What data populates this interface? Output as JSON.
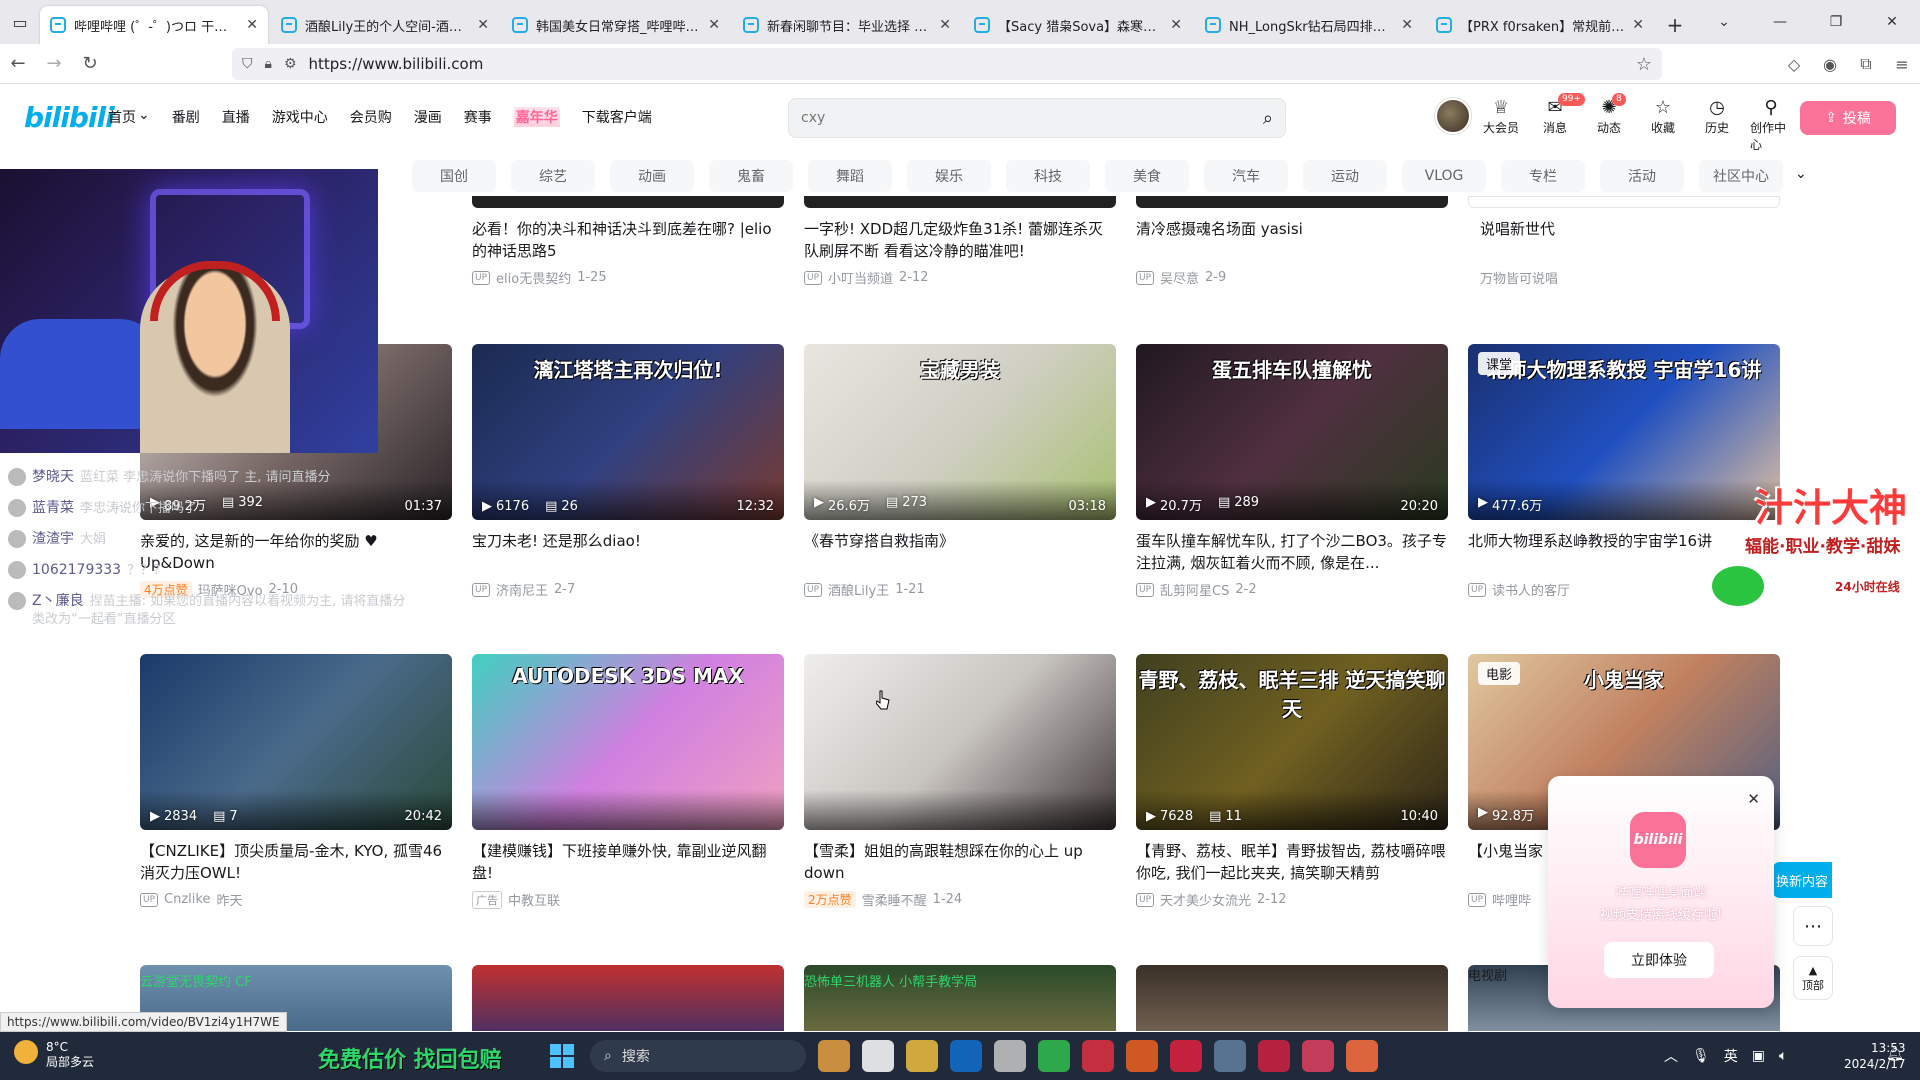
{
  "browser": {
    "tabs": [
      {
        "label": "哔哩哔哩 (゜-゜)つロ 干杯~-bi",
        "active": true
      },
      {
        "label": "酒酿Lily王的个人空间-酒酿Lily",
        "active": false
      },
      {
        "label": "韩国美女日常穿搭_哔哩哔哩_bi",
        "active": false
      },
      {
        "label": "新春闲聊节目：毕业选择 | 为什",
        "active": false
      },
      {
        "label": "【Sacy 猎枭Sova】森寒冬港29",
        "active": false
      },
      {
        "label": "NH_LongSkr钻石局四排20杀秒",
        "active": false
      },
      {
        "label": "【PRX f0rsaken】常规前压和",
        "active": false
      }
    ],
    "url": "https://www.bilibili.com",
    "status_url": "https://www.bilibili.com/video/BV1zi4y1H7WE"
  },
  "header": {
    "logo": "bilibili",
    "nav": [
      "首页",
      "番剧",
      "直播",
      "游戏中心",
      "会员购",
      "漫画",
      "赛事",
      "嘉年华",
      "下载客户端"
    ],
    "search_placeholder": "cxy",
    "icons": [
      {
        "label": "大会员",
        "icon": "vip-icon",
        "badge": ""
      },
      {
        "label": "消息",
        "icon": "message-icon",
        "badge": "99+"
      },
      {
        "label": "动态",
        "icon": "dynamic-icon",
        "badge": "8"
      },
      {
        "label": "收藏",
        "icon": "star-icon",
        "badge": ""
      },
      {
        "label": "历史",
        "icon": "history-icon",
        "badge": ""
      },
      {
        "label": "创作中心",
        "icon": "bulb-icon",
        "badge": ""
      }
    ],
    "upload": "投稿"
  },
  "channels": [
    "国创",
    "综艺",
    "动画",
    "鬼畜",
    "舞蹈",
    "娱乐",
    "科技",
    "美食",
    "汽车",
    "运动",
    "VLOG",
    "专栏",
    "活动",
    "社区中心"
  ],
  "row0": [
    {
      "title": "必看！你的决斗和神话决斗到底差在哪? |elio的神话思路5",
      "up": "elio无畏契约",
      "date": "1-25"
    },
    {
      "title": "一字秒! XDD超几定级炸鱼31杀! 蕾娜连杀灭队刷屏不断 看看这冷静的瞄准吧!",
      "up": "小叮当频道",
      "date": "2-12"
    },
    {
      "title": "清冷感摄魂名场面 yasisi",
      "up": "吴尽意",
      "date": "2-9"
    },
    {
      "title": "说唱新世代",
      "up": "万物皆可说唱",
      "date": ""
    }
  ],
  "row1": [
    {
      "views": "89.2万",
      "danmaku": "392",
      "duration": "01:37",
      "overlay": "",
      "tag": "",
      "title": "亲爱的, 这是新的一年给你的奖励 ♥ Up&Down",
      "pill": "4万点赞",
      "up": "玛萨咪Ovo",
      "date": "2-10"
    },
    {
      "views": "6176",
      "danmaku": "26",
      "duration": "12:32",
      "overlay": "漓江塔塔主再次归位!",
      "tag": "",
      "title": "宝刀未老! 还是那么diao!",
      "pill": "",
      "up": "济南尼王",
      "date": "2-7"
    },
    {
      "views": "26.6万",
      "danmaku": "273",
      "duration": "03:18",
      "overlay": "宝藏男装",
      "tag": "",
      "title": "《春节穿搭自救指南》",
      "pill": "",
      "up": "酒酿Lily王",
      "date": "1-21"
    },
    {
      "views": "20.7万",
      "danmaku": "289",
      "duration": "20:20",
      "overlay": "蛋五排车队撞解忧",
      "tag": "",
      "title": "蛋车队撞车解忧车队, 打了个沙二BO3。孩子专注拉满, 烟灰缸着火而不顾, 像是在...",
      "pill": "",
      "up": "乱剪阿星CS",
      "date": "2-2"
    },
    {
      "views": "477.6万",
      "danmaku": "",
      "duration": "",
      "overlay": "北师大物理系教授 宇宙学16讲",
      "tag": "课堂",
      "title": "北师大物理系赵峥教授的宇宙学16讲",
      "pill": "",
      "up": "读书人的客厅",
      "date": ""
    }
  ],
  "row2": [
    {
      "views": "2834",
      "danmaku": "7",
      "duration": "20:42",
      "overlay": "",
      "tag": "",
      "title": "【CNZLIKE】顶尖质量局-金木, KYO, 孤雪46消灭力压OWL!",
      "pill": "",
      "ad": "",
      "up": "Cnzlike",
      "date": "昨天"
    },
    {
      "views": "",
      "danmaku": "",
      "duration": "",
      "overlay": "AUTODESK 3DS MAX",
      "tag": "",
      "title": "【建模赚钱】下班接单赚外快, 靠副业逆风翻盘!",
      "pill": "",
      "ad": "广告",
      "up": "中教互联",
      "date": ""
    },
    {
      "views": "",
      "danmaku": "",
      "duration": "",
      "overlay": "",
      "tag": "",
      "title": "【雪柔】姐姐的高跟鞋想踩在你的心上 up down",
      "pill": "2万点赞",
      "ad": "",
      "up": "雪柔睡不醒",
      "date": "1-24"
    },
    {
      "views": "7628",
      "danmaku": "11",
      "duration": "10:40",
      "overlay": "青野、荔枝、眠羊三排 逆天搞笑聊天",
      "tag": "",
      "title": "【青野、荔枝、眠羊】青野拔智齿, 荔枝嚼碎喂你吃, 我们一起比夹夹, 搞笑聊天精剪",
      "pill": "",
      "ad": "",
      "up": "天才美少女流光",
      "date": "2-12"
    },
    {
      "views": "92.8万",
      "danmaku": "",
      "duration": "",
      "overlay": "小鬼当家",
      "tag": "电影",
      "title": "【小鬼当家",
      "pill": "",
      "ad": "",
      "up": "哔哩哔",
      "date": ""
    }
  ],
  "row3": [
    {
      "overlay": "云游堂无畏契约 CF"
    },
    {
      "overlay": ""
    },
    {
      "overlay": "恐怖单三机器人 小帮手教学局"
    },
    {
      "overlay": ""
    },
    {
      "overlay": "电视剧"
    }
  ],
  "stream": {
    "chat": [
      {
        "name": "梦晓天",
        "text": "蓝红菜 李忠涛说你下播吗了 主, 请问直播分"
      },
      {
        "name": "蓝青菜",
        "text": "李忠涛说你下播吗了"
      },
      {
        "name": "渣渣宇",
        "text": "大娟"
      },
      {
        "name": "1062179333",
        "text": "？？？"
      },
      {
        "name": "Z丶廉良",
        "text": "捏苗主播: 如果您的直播内容以看视频为主, 请将直播分类改为“一起看”直播分区"
      }
    ],
    "overlay_title": "汁汁大神",
    "overlay_sub": "辐能·职业·教学·甜妹",
    "overlay_note": "24小时在线",
    "promo": "免费估价 找回包赔"
  },
  "popup": {
    "logo": "bilibili",
    "line1": "哔哩哔哩桌面端",
    "line2": "视频支持离线缓存啦!",
    "button": "立即体验"
  },
  "side": {
    "refresh": "换新内容",
    "top": "顶部"
  },
  "taskbar": {
    "temp": "8°C",
    "weather": "局部多云",
    "search": "搜索",
    "lang": "英",
    "time": "13:53",
    "date": "2024/2/17"
  },
  "colors": {
    "brand": "#00aeec",
    "pink": "#fb7299"
  }
}
